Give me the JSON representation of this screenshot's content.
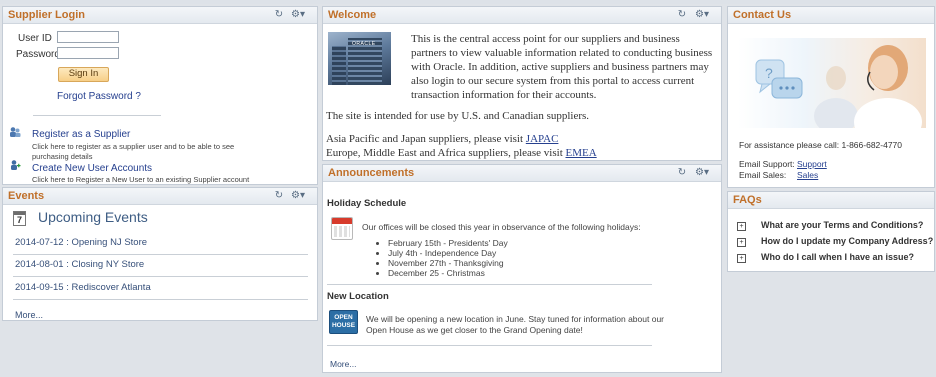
{
  "supplier_login": {
    "title": "Supplier Login",
    "user_id_label": "User ID",
    "password_label": "Password",
    "user_id_value": "",
    "password_value": "",
    "sign_in_label": "Sign In",
    "forgot_password": "Forgot Password ?",
    "register_link": "Register as a Supplier",
    "register_desc_1": "Click here to register as a supplier user and to be able to see",
    "register_desc_2": "purchasing details",
    "create_users_link": "Create New User Accounts",
    "create_users_desc": "Click here to Register a New User to an existing Supplier account"
  },
  "welcome": {
    "title": "Welcome",
    "image_text": "ORACLE",
    "para1": "This is the central access point for our suppliers and business partners to view valuable information related to conducting business with Oracle.  In addition, active suppliers and business partners may also login to our secure system from this portal to access current transaction information for their accounts.",
    "para2": "The site is intended for use by U.S. and Canadian suppliers.",
    "apj_prefix": "Asia Pacific and Japan suppliers, please visit ",
    "apj_link": "JAPAC",
    "emea_prefix": "Europe, Middle East and Africa suppliers, please visit ",
    "emea_link": "EMEA"
  },
  "contact": {
    "title": "Contact Us",
    "phone_text": "For assistance please call:  1-866-682-4770",
    "email_support_label": "Email Support:",
    "email_support_link": "Support",
    "email_sales_label": "Email Sales:",
    "email_sales_link": "Sales"
  },
  "events": {
    "title": "Events",
    "calendar_day": "7",
    "heading": "Upcoming Events",
    "items": [
      "2014-07-12 : Opening NJ Store",
      "2014-08-01 : Closing NY Store",
      "2014-09-15 : Rediscover Atlanta"
    ],
    "more": "More..."
  },
  "announcements": {
    "title": "Announcements",
    "holiday_title": "Holiday Schedule",
    "holiday_intro": "Our offices will be closed this year in observance of the following holidays:",
    "holidays": [
      "February 15th - Presidents' Day",
      "July 4th - Independence Day",
      "November 27th - Thanksgiving",
      "December 25 - Christmas"
    ],
    "location_title": "New Location",
    "location_text_1": "We will be opening a new location in June.  Stay tuned for information about  our",
    "location_text_2": "Open House as we get closer to the Grand Opening date!",
    "open_house_badge_1": "OPEN",
    "open_house_badge_2": "HOUSE",
    "more": "More..."
  },
  "faqs": {
    "title": "FAQs",
    "items": [
      "What are your Terms and Conditions?",
      "How do I update my Company Address?",
      "Who do I call when I have an issue?"
    ]
  },
  "icons": {
    "refresh": "refresh-icon",
    "gear": "gear-icon",
    "expand": "plus-box-icon"
  },
  "colors": {
    "title": "#c0702a",
    "link": "#26408f",
    "button": "#f7cf88"
  }
}
